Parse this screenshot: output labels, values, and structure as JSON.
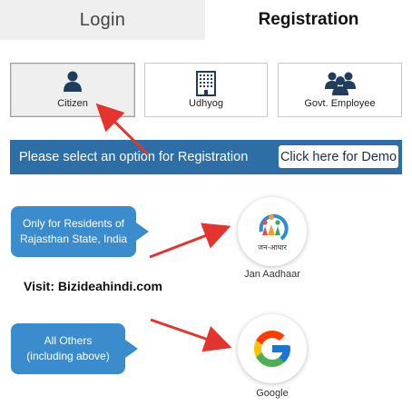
{
  "tabs": {
    "login": "Login",
    "registration": "Registration"
  },
  "options": [
    {
      "label": "Citizen",
      "icon": "person-icon",
      "selected": true
    },
    {
      "label": "Udhyog",
      "icon": "building-icon",
      "selected": false
    },
    {
      "label": "Govt. Employee",
      "icon": "group-icon",
      "selected": false
    }
  ],
  "banner": {
    "text": "Please select an option for Registration",
    "demo_button": "Click here for Demo"
  },
  "jan_aadhaar": {
    "bubble_line1": "Only for Residents of",
    "bubble_line2": "Rajasthan State, India",
    "logo_text": "जन-आधार",
    "caption": "Jan Aadhaar"
  },
  "visit_text": "Visit: Bizideahindi.com",
  "google": {
    "bubble_line1": "All Others",
    "bubble_line2": "(including above)",
    "caption": "Google"
  },
  "colors": {
    "banner": "#2d6ea6",
    "bubble": "#3b8ccc",
    "arrow": "#e3342f",
    "icon": "#1f3e5e"
  }
}
